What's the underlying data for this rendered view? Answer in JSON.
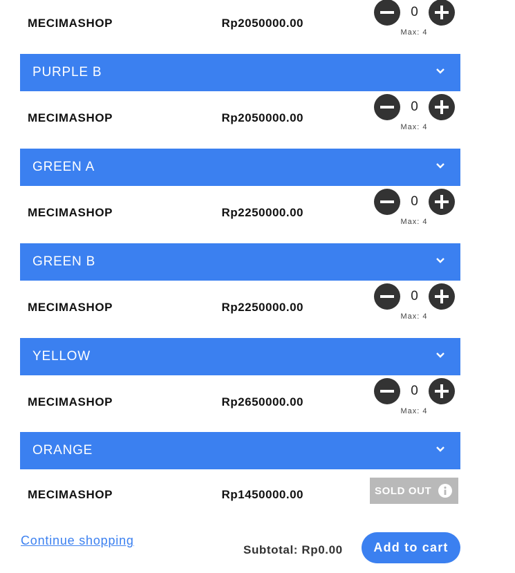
{
  "items": [
    {
      "seller": "MECIMASHOP",
      "price": "Rp2050000.00",
      "qty": "0",
      "max": "Max: 4"
    },
    {
      "variant": "PURPLE B",
      "seller": "MECIMASHOP",
      "price": "Rp2050000.00",
      "qty": "0",
      "max": "Max: 4"
    },
    {
      "variant": "GREEN A",
      "seller": "MECIMASHOP",
      "price": "Rp2250000.00",
      "qty": "0",
      "max": "Max: 4"
    },
    {
      "variant": "GREEN B",
      "seller": "MECIMASHOP",
      "price": "Rp2250000.00",
      "qty": "0",
      "max": "Max: 4"
    },
    {
      "variant": "YELLOW",
      "seller": "MECIMASHOP",
      "price": "Rp2650000.00",
      "qty": "0",
      "max": "Max: 4"
    },
    {
      "variant": "ORANGE",
      "seller": "MECIMASHOP",
      "price": "Rp1450000.00",
      "status": "SOLD OUT"
    }
  ],
  "footer": {
    "continue_label": "Continue shopping",
    "subtotal": "Subtotal: Rp0.00",
    "add_to_cart_label": "Add to cart"
  },
  "icons": {
    "minus": "minus-circle-icon",
    "plus": "plus-circle-icon",
    "chevron": "chevron-down-icon",
    "info": "info-icon"
  },
  "colors": {
    "accent": "#3b80f0",
    "button_dark": "#333333",
    "sold_out_bg": "#b9b9b9"
  }
}
